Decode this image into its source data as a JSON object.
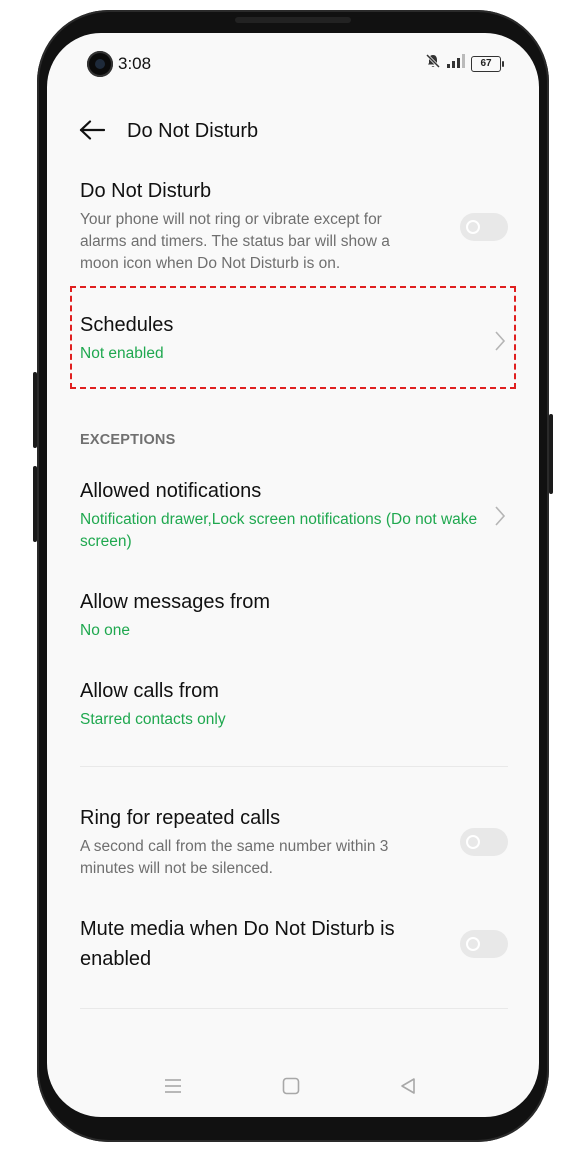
{
  "status_bar": {
    "time": "3:08",
    "battery": "67",
    "icons": [
      "bell-off-icon",
      "signal-icon",
      "battery-icon"
    ]
  },
  "header": {
    "title": "Do Not Disturb",
    "back_icon": "arrow-left-icon"
  },
  "dnd": {
    "title": "Do Not Disturb",
    "description": "Your phone will not ring or vibrate except for alarms and timers. The status bar will show a moon icon when Do Not Disturb is on.",
    "enabled": false
  },
  "schedules": {
    "title": "Schedules",
    "status": "Not enabled"
  },
  "exceptions": {
    "header": "EXCEPTIONS",
    "allowed_notifications": {
      "title": "Allowed notifications",
      "value": "Notification drawer,Lock screen notifications (Do not wake screen)"
    },
    "allow_messages": {
      "title": "Allow messages from",
      "value": "No one"
    },
    "allow_calls": {
      "title": "Allow calls from",
      "value": "Starred contacts only"
    }
  },
  "ring_repeated": {
    "title": "Ring for repeated calls",
    "description": "A second call from the same number within 3 minutes will not be silenced.",
    "enabled": false
  },
  "mute_media": {
    "title": "Mute media when Do Not Disturb is enabled",
    "enabled": false
  },
  "colors": {
    "accent_green": "#1fa84f",
    "highlight_red": "#e02020",
    "background": "#f9f9f9"
  },
  "nav_bar": {
    "icons": [
      "menu-icon",
      "home-icon",
      "back-triangle-icon"
    ]
  }
}
